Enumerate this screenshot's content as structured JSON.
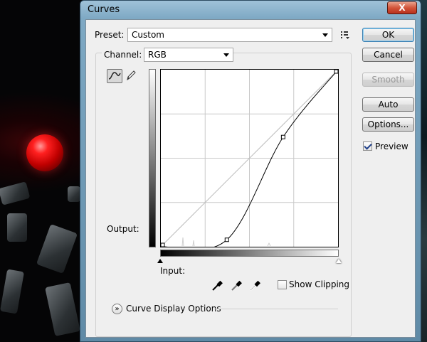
{
  "dialog": {
    "title": "Curves",
    "close_label": "X",
    "preset_label": "Preset:",
    "preset_value": "Custom",
    "channel_label": "Channel:",
    "channel_value": "RGB",
    "output_label": "Output:",
    "input_label": "Input:",
    "show_clipping_label": "Show Clipping",
    "show_clipping_checked": false,
    "preview_label": "Preview",
    "preview_checked": true,
    "curve_display_options_label": "Curve Display Options",
    "buttons": {
      "ok": "OK",
      "cancel": "Cancel",
      "smooth": "Smooth",
      "auto": "Auto",
      "options": "Options..."
    }
  },
  "icons": {
    "preset_menu": "preset-options-icon",
    "curve_tool": "curve-tool-icon",
    "pencil_tool": "pencil-tool-icon",
    "eyedroppers": [
      "black-point-eyedropper-icon",
      "gray-point-eyedropper-icon",
      "white-point-eyedropper-icon"
    ],
    "expander": "chevron-down-icon"
  },
  "curve": {
    "points": [
      [
        0,
        0
      ],
      [
        95,
        10
      ],
      [
        176,
        158
      ],
      [
        255,
        255
      ]
    ]
  },
  "colors": {
    "dialog_frame": "#7ea9c4",
    "close_button": "#d2553a",
    "client_bg": "#efefef"
  }
}
